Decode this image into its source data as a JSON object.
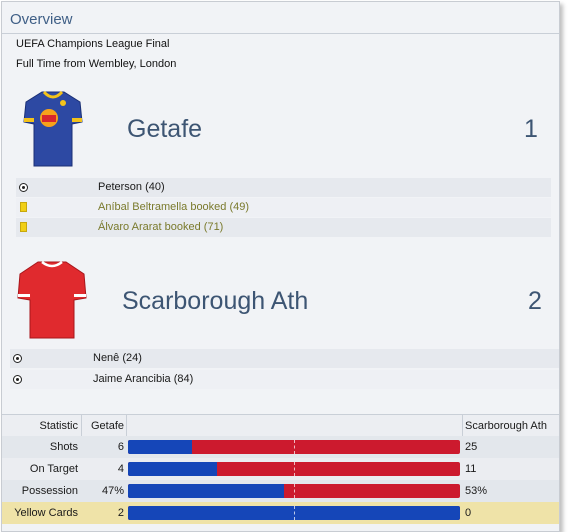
{
  "header": {
    "title": "Overview",
    "competition": "UEFA Champions League Final",
    "result_line": "Full Time from Wembley, London"
  },
  "home": {
    "name": "Getafe",
    "score": "1",
    "shirt_colors": {
      "body": "#2d49a3",
      "trim": "#f3c21a"
    },
    "events": [
      {
        "icon": "soccer-ball-icon",
        "type": "goal",
        "text": "Peterson (40)"
      },
      {
        "icon": "yellow-card-icon",
        "type": "booking",
        "text": "Aníbal Beltramella booked (49)"
      },
      {
        "icon": "yellow-card-icon",
        "type": "booking",
        "text": "Álvaro Ararat booked (71)"
      }
    ]
  },
  "away": {
    "name": "Scarborough Ath",
    "score": "2",
    "shirt_colors": {
      "body": "#e02a2e",
      "trim": "#ffffff"
    },
    "events": [
      {
        "icon": "soccer-ball-icon",
        "type": "goal",
        "text": "Nenê (24)"
      },
      {
        "icon": "soccer-ball-icon",
        "type": "goal",
        "text": "Jaime Arancibia (84)"
      }
    ]
  },
  "stats": {
    "headers": {
      "statistic": "Statistic",
      "home": "Getafe",
      "away": "Scarborough Ath"
    },
    "colors": {
      "home": "#1546b8",
      "away": "#cc1a2e"
    },
    "rows": [
      {
        "label": "Shots",
        "home": "6",
        "away": "25",
        "home_share": 0.194
      },
      {
        "label": "On Target",
        "home": "4",
        "away": "11",
        "home_share": 0.267
      },
      {
        "label": "Possession",
        "home": "47%",
        "away": "53%",
        "home_share": 0.47
      },
      {
        "label": "Yellow Cards",
        "home": "2",
        "away": "0",
        "home_share": 1.0
      }
    ]
  }
}
